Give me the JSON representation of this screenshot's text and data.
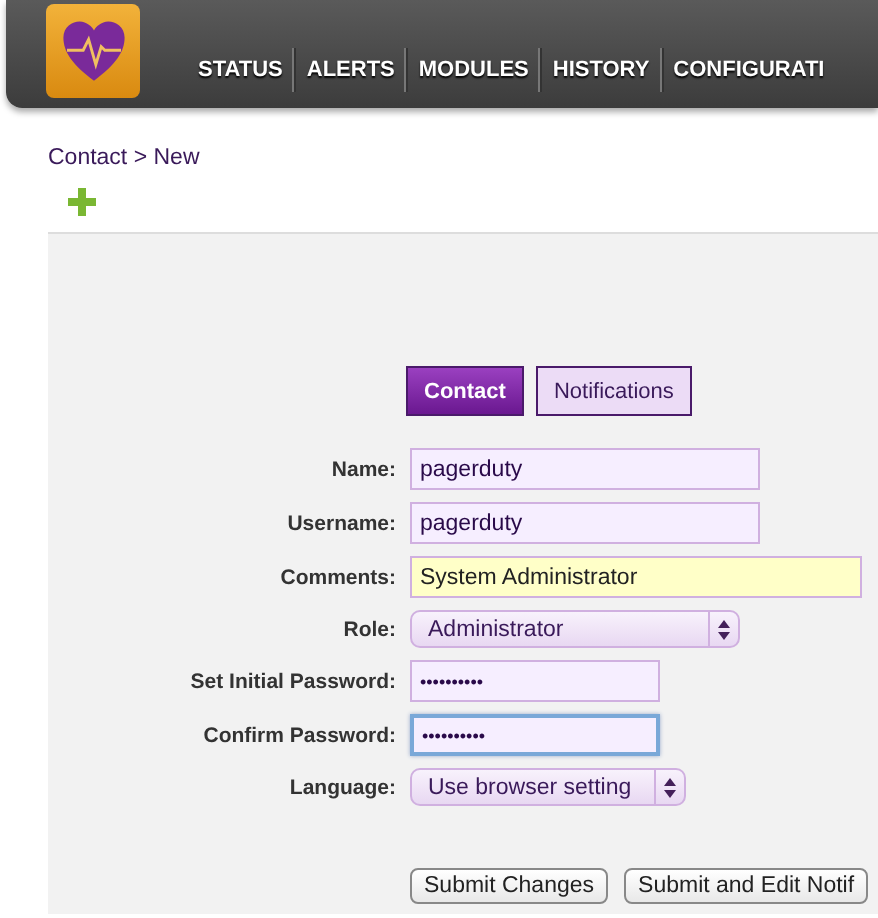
{
  "nav": [
    {
      "label": "STATUS"
    },
    {
      "label": "ALERTS"
    },
    {
      "label": "MODULES"
    },
    {
      "label": "HISTORY"
    },
    {
      "label": "CONFIGURATI"
    }
  ],
  "breadcrumb": "Contact > New",
  "tabs": [
    {
      "label": "Contact",
      "selected": true
    },
    {
      "label": "Notifications",
      "selected": false
    }
  ],
  "fields": [
    {
      "label": "Name:",
      "kind": "text",
      "value": "pagerduty",
      "focused": false
    },
    {
      "label": "Username:",
      "kind": "text",
      "value": "pagerduty",
      "focused": false
    },
    {
      "label": "Comments:",
      "kind": "comment",
      "value": "System Administrator",
      "focused": false
    },
    {
      "label": "Role:",
      "kind": "select",
      "value": "Administrator",
      "focused": false
    },
    {
      "label": "Set Initial Password:",
      "kind": "password",
      "value": "••••••••••",
      "focused": false
    },
    {
      "label": "Confirm Password:",
      "kind": "password",
      "value": "••••••••••",
      "focused": true
    },
    {
      "label": "Language:",
      "kind": "smallselect",
      "value": "Use browser setting",
      "focused": false
    }
  ],
  "buttons": [
    "Submit Changes",
    "Submit and Edit Notif"
  ]
}
